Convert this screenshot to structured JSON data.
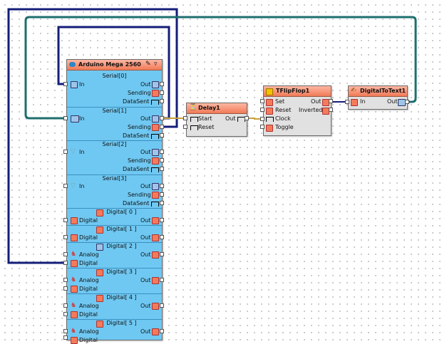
{
  "arduino": {
    "title": "Arduino Mega 2560",
    "serial_sections": [
      {
        "title": "Serial[0]",
        "in": "In",
        "out": "Out",
        "sending": "Sending",
        "datasent": "DataSent"
      },
      {
        "title": "Serial[1]",
        "in": "In",
        "out": "Out",
        "sending": "Sending",
        "datasent": "DataSent"
      },
      {
        "title": "Serial[2]",
        "in": "In",
        "out": "Out",
        "sending": "Sending",
        "datasent": "DataSent"
      },
      {
        "title": "Serial[3]",
        "in": "In",
        "out": "Out",
        "sending": "Sending",
        "datasent": "DataSent"
      }
    ],
    "digital_sections": [
      {
        "title": "Digital[ 0 ]",
        "analog": "",
        "digital": "Digital",
        "out": "Out"
      },
      {
        "title": "Digital[ 1 ]",
        "analog": "",
        "digital": "Digital",
        "out": "Out"
      },
      {
        "title": "Digital[ 2 ]",
        "analog": "Analog",
        "digital": "Digital",
        "out": "Out"
      },
      {
        "title": "Digital[ 3 ]",
        "analog": "Analog",
        "digital": "Digital",
        "out": "Out"
      },
      {
        "title": "Digital[ 4 ]",
        "analog": "Analog",
        "digital": "Digital",
        "out": "Out"
      },
      {
        "title": "Digital[ 5 ]",
        "analog": "Analog",
        "digital": "Digital",
        "out": "Out"
      }
    ]
  },
  "delay": {
    "title": "Delay1",
    "start": "Start",
    "reset": "Reset",
    "out": "Out"
  },
  "flipflop": {
    "title": "TFlipFlop1",
    "set": "Set",
    "reset": "Reset",
    "clock": "Clock",
    "toggle": "Toggle",
    "out": "Out",
    "inverted": "Inverted"
  },
  "digitaltotext": {
    "title": "DigitalToText1",
    "in": "In",
    "out": "Out"
  },
  "colors": {
    "wire_navy": "#141e78",
    "wire_teal": "#1e6e6e",
    "wire_gold": "#c8a03c",
    "header": "#f07a57",
    "body": "#6fc8f2"
  }
}
